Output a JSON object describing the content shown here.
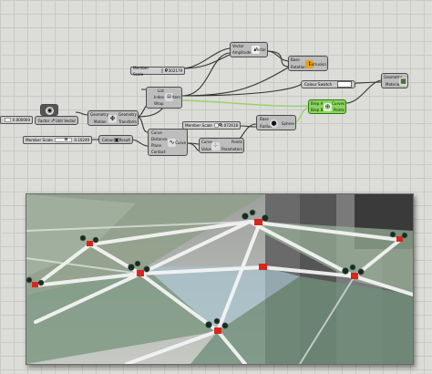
{
  "canvas": {
    "sliders": [
      {
        "label": "Member Scale",
        "value": "0.502179"
      },
      {
        "label": "Member Scale",
        "value": "0.10249"
      },
      {
        "label": "Member Scale",
        "value": "0.072618"
      },
      {
        "label": "Member Scale",
        "value": "0.10"
      }
    ],
    "components": {
      "vector": {
        "in1": "Vector",
        "in2": "Amplitude",
        "out": "Vector"
      },
      "rotate": {
        "in1": "Base",
        "in2": "Rotation",
        "out": "Extrusion"
      },
      "list": {
        "in1": "List",
        "in2": "Index",
        "in3": "Wrap",
        "out": "Item"
      },
      "shatter": {
        "in1": "Geometry",
        "in2": "Motion",
        "out1": "Geometry",
        "out2": "Transform"
      },
      "factor": {
        "in": "Factor",
        "out": "Unit Vector"
      },
      "colour": {
        "in": "Colour",
        "out": "Result"
      },
      "divide": {
        "in1": "Curve",
        "in2": "Distance",
        "in3": "Plane",
        "in4": "Contact",
        "out": "Curve"
      },
      "points": {
        "in1": "Curve",
        "in2": "Value",
        "out1": "Points",
        "out2": "Parameters"
      },
      "sphere": {
        "in1": "Base",
        "in2": "Radius",
        "out": "Sphere"
      },
      "curves": {
        "in1": "Brep A",
        "in2": "Brep B",
        "out1": "Curves",
        "out2": "Points"
      },
      "colour_swatch": {
        "label": "Colour Swatch"
      },
      "preview": {
        "in1": "Geometry",
        "in2": "Material"
      }
    },
    "edge_label": "0.000000"
  },
  "colors": {
    "accent_green": "#8ad65c",
    "canvas": "#dcdcd8",
    "warning": "#e8a317",
    "viewport_red": "#d7261e"
  }
}
